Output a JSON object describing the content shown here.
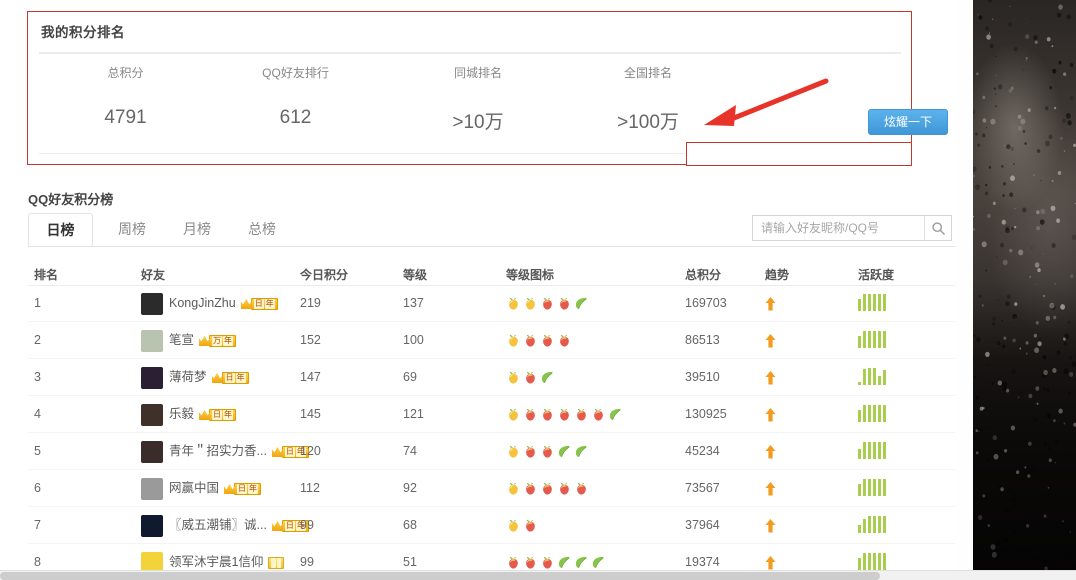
{
  "rank_panel": {
    "title": "我的积分排名",
    "columns": [
      {
        "label": "总积分",
        "value": "4791"
      },
      {
        "label": "QQ好友排行",
        "value": "612"
      },
      {
        "label": "同城排名",
        "value": ">10万"
      },
      {
        "label": "全国排名",
        "value": ">100万"
      }
    ],
    "show_off_button": "炫耀一下",
    "highlight_color": "#c0392b",
    "button_color": "#4ea3e0",
    "red_input_value": ""
  },
  "board": {
    "title": "QQ好友积分榜",
    "tabs": [
      {
        "label": "日榜",
        "active": true
      },
      {
        "label": "周榜",
        "active": false
      },
      {
        "label": "月榜",
        "active": false
      },
      {
        "label": "总榜",
        "active": false
      }
    ],
    "search": {
      "placeholder": "请输入好友昵称/QQ号",
      "value": "",
      "icon": "search-icon"
    },
    "headers": [
      "排名",
      "好友",
      "今日积分",
      "等级",
      "等级图标",
      "总积分",
      "趋势",
      "活跃度"
    ],
    "trend_icon": "arrow-up-icon",
    "rows": [
      {
        "rank": "1",
        "name": "KongJinZhu",
        "badge": "日年",
        "badge_crown": true,
        "today": "219",
        "level": "137",
        "total": "169703",
        "trend": "up",
        "icons": [
          "yellow",
          "yellow",
          "red",
          "red",
          "leaf"
        ],
        "activity": [
          70,
          100,
          100,
          100,
          100,
          100
        ],
        "avatar": "#2b2b2b"
      },
      {
        "rank": "2",
        "name": "笔宣",
        "badge": "万年",
        "badge_crown": true,
        "today": "152",
        "level": "100",
        "total": "86513",
        "trend": "up",
        "icons": [
          "yellow",
          "red",
          "red",
          "red"
        ],
        "activity": [
          70,
          100,
          100,
          100,
          100,
          100
        ],
        "avatar": "#b8c4b0"
      },
      {
        "rank": "3",
        "name": "薄荷梦",
        "badge": "日年",
        "badge_crown": true,
        "today": "147",
        "level": "69",
        "total": "39510",
        "trend": "up",
        "icons": [
          "yellow",
          "red",
          "leaf"
        ],
        "activity": [
          20,
          95,
          100,
          100,
          55,
          90
        ],
        "avatar": "#2a1f33"
      },
      {
        "rank": "4",
        "name": "乐毅",
        "badge": "日年",
        "badge_crown": true,
        "today": "145",
        "level": "121",
        "total": "130925",
        "trend": "up",
        "icons": [
          "yellow",
          "red",
          "red",
          "red",
          "red",
          "red",
          "leaf"
        ],
        "activity": [
          70,
          100,
          100,
          100,
          100,
          100
        ],
        "avatar": "#40302a"
      },
      {
        "rank": "5",
        "name": "青年＂招实力香...",
        "badge": "日年",
        "badge_crown": true,
        "today": "120",
        "level": "74",
        "total": "45234",
        "trend": "up",
        "icons": [
          "yellow",
          "red",
          "red",
          "leaf",
          "leaf"
        ],
        "activity": [
          60,
          100,
          100,
          100,
          100,
          100
        ],
        "avatar": "#3a2c28"
      },
      {
        "rank": "6",
        "name": "网赢中国",
        "badge": "日年",
        "badge_crown": true,
        "today": "112",
        "level": "92",
        "total": "73567",
        "trend": "up",
        "icons": [
          "yellow",
          "red",
          "red",
          "red",
          "red"
        ],
        "activity": [
          70,
          100,
          100,
          100,
          100,
          100
        ],
        "avatar": "#9a9a9a"
      },
      {
        "rank": "7",
        "name": "〖威五潮铺〗诚...",
        "badge": "日年",
        "badge_crown": true,
        "today": "99",
        "level": "68",
        "total": "37964",
        "trend": "up",
        "icons": [
          "yellow",
          "red"
        ],
        "activity": [
          45,
          85,
          100,
          100,
          100,
          100
        ],
        "avatar": "#101a2e"
      },
      {
        "rank": "8",
        "name": "领军沐宇晨1信仰",
        "badge": "",
        "badge_crown": false,
        "today": "99",
        "level": "51",
        "total": "19374",
        "trend": "up",
        "icons": [
          "red",
          "red",
          "red",
          "leaf",
          "leaf",
          "leaf"
        ],
        "activity": [
          70,
          100,
          100,
          100,
          100,
          100
        ],
        "avatar": "#f2d33a"
      }
    ]
  },
  "colors": {
    "activity_bar": "#a8cd4f",
    "trend_up": "#f29b1e",
    "icon_yellow": "#f5c33c",
    "icon_red": "#e65a4e",
    "icon_leaf": "#86c44a"
  }
}
